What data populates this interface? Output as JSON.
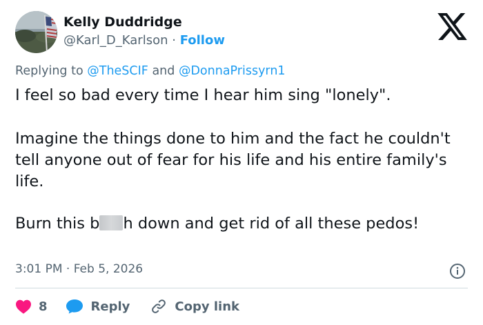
{
  "author": {
    "name": "Kelly Duddridge",
    "handle": "@Karl_D_Karlson",
    "separator": "·",
    "follow_label": "Follow",
    "avatar_icon": "avatar-flag-photo"
  },
  "platform_icon": "x-logo-icon",
  "reply_context": {
    "prefix": "Replying to",
    "mention1": "@TheSCIF",
    "conjunction": "and",
    "mention2": "@DonnaPrissyrn1"
  },
  "tweet": {
    "line1": "I feel so bad every time I hear him sing \"lonely\".",
    "paragraph2": "Imagine the things done to him and the fact he couldn't tell anyone out of fear for his life and his entire family's life.",
    "p3_before": "Burn this b",
    "p3_after": "h down and get rid of all these pedos!"
  },
  "meta": {
    "timestamp": "3:01 PM · Feb 5, 2026"
  },
  "actions": {
    "like_count": "8",
    "reply_label": "Reply",
    "copy_label": "Copy link"
  },
  "colors": {
    "text": "#0f1419",
    "secondary": "#536471",
    "accent": "#1d9bf0",
    "like": "#f91880",
    "divider": "#cfd9de"
  }
}
